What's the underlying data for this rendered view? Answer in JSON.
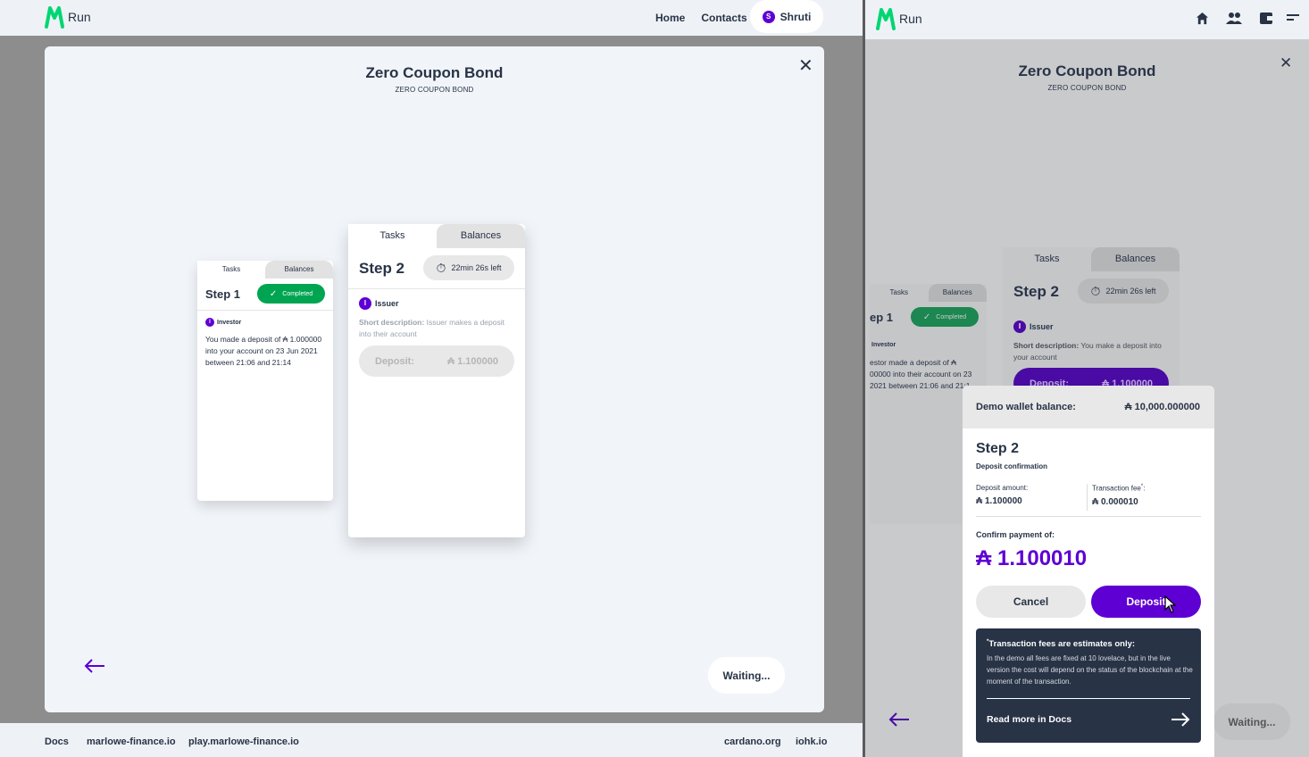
{
  "left": {
    "brand": "Run",
    "nav": {
      "home": "Home",
      "contacts": "Contacts",
      "user_initial": "S",
      "user_name": "Shruti"
    },
    "modal": {
      "title": "Zero Coupon Bond",
      "subtitle": "ZERO COUPON BOND",
      "card1": {
        "tab_tasks": "Tasks",
        "tab_balances": "Balances",
        "step": "Step 1",
        "status": "Completed",
        "role_initial": "I",
        "role": "Investor",
        "text": "You made a deposit of ₳ 1.000000 into your account on 23 Jun 2021 between 21:06 and 21:14"
      },
      "card2": {
        "tab_tasks": "Tasks",
        "tab_balances": "Balances",
        "step": "Step 2",
        "timer": "22min 26s left",
        "role_initial": "I",
        "role": "Issuer",
        "desc_label": "Short description:",
        "desc_text": "Issuer makes a deposit into their account",
        "deposit_label": "Deposit:",
        "deposit_value": "₳ 1.100000"
      },
      "waiting": "Waiting..."
    },
    "footer": {
      "docs": "Docs",
      "marlowe": "marlowe-finance.io",
      "play": "play.marlowe-finance.io",
      "cardano": "cardano.org",
      "iohk": "iohk.io"
    }
  },
  "right": {
    "brand": "Run",
    "icons": [
      "home-icon",
      "contacts-icon",
      "wallet-icon",
      "menu-icon"
    ],
    "modal": {
      "title": "Zero Coupon Bond",
      "subtitle": "ZERO COUPON BOND",
      "card1": {
        "tab_tasks": "Tasks",
        "tab_balances": "Balances",
        "step": "ep 1",
        "status": "Completed",
        "role": "Investor",
        "text_line1": "estor made a deposit of ₳",
        "text_line2": "00000 into their account on 23",
        "text_line3": "2021 between 21:06 and 21:1"
      },
      "card2": {
        "tab_tasks": "Tasks",
        "tab_balances": "Balances",
        "step": "Step 2",
        "timer": "22min 26s left",
        "role_initial": "I",
        "role": "Issuer",
        "desc_label": "Short description:",
        "desc_text": "You make a deposit into your account",
        "deposit_label": "Deposit:",
        "deposit_value": "₳ 1.100000"
      },
      "waiting": "Waiting..."
    },
    "wallet_popup": {
      "balance_label": "Demo wallet balance:",
      "balance_value": "₳ 10,000.000000",
      "step": "Step 2",
      "subtitle": "Deposit confirmation",
      "deposit_amount_label": "Deposit amount:",
      "deposit_amount_value": "₳ 1.100000",
      "fee_label": "Transaction fee",
      "fee_mark": "*",
      "fee_colon": ":",
      "fee_value": "₳ 0.000010",
      "confirm_label": "Confirm payment of:",
      "confirm_value": "₳ 1.100010",
      "cancel": "Cancel",
      "deposit": "Deposit",
      "note_title": "Transaction fees are estimates only:",
      "note_mark": "*",
      "note_text": "In the demo all fees are fixed at 10 lovelace, but in the live version the cost will depend on the status of the blockchain at the moment of the transaction.",
      "read_more": "Read more in Docs"
    }
  },
  "colors": {
    "accent": "#5e00d3",
    "completed": "#00a551",
    "dark_panel": "#283346",
    "overlay": "#8d8d8d"
  }
}
